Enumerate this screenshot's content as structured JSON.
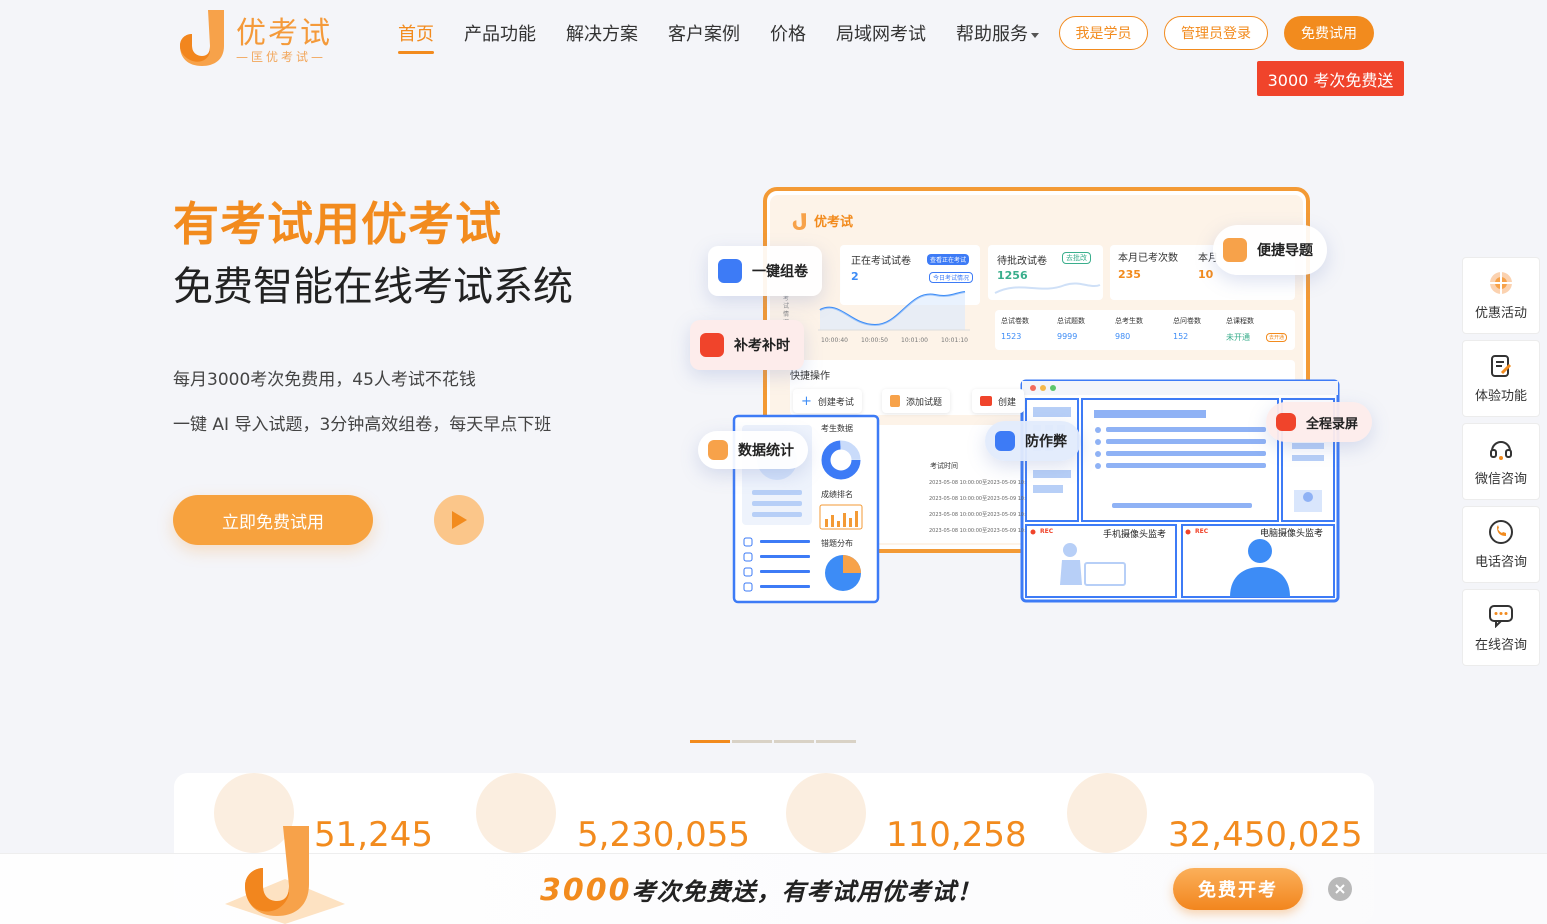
{
  "header": {
    "logo": {
      "title": "优考试",
      "subtitle": "—匡优考试—"
    },
    "nav": [
      {
        "label": "首页",
        "active": true
      },
      {
        "label": "产品功能"
      },
      {
        "label": "解决方案"
      },
      {
        "label": "客户案例"
      },
      {
        "label": "价格"
      },
      {
        "label": "局域网考试"
      },
      {
        "label": "帮助服务"
      }
    ],
    "student_btn": "我是学员",
    "admin_btn": "管理员登录",
    "trial_btn": "免费试用",
    "promo_tag": "3000 考次免费送"
  },
  "hero": {
    "title": "有考试用优考试",
    "subtitle": "免费智能在线考试系统",
    "line1": "每月3000考次免费用，45人考试不花钱",
    "line2": "一键 AI 导入试题，3分钟高效组卷，每天早点下班",
    "cta": "立即免费试用"
  },
  "illustration": {
    "app_name": "优考试",
    "chips": {
      "one_click": "一键组卷",
      "makeup": "补考补时",
      "data_stats": "数据统计",
      "anti_cheat": "防作弊",
      "quick_import": "便捷导题",
      "record": "全程录屏"
    },
    "cards": {
      "exams_in_progress": "正在考试试卷",
      "exams_in_progress_val": "2",
      "badge_view": "查看正在考试",
      "badge_today": "今日考试情况",
      "pending": "待批改试卷",
      "pending_val": "1256",
      "pending_badge": "去批改",
      "month_count": "本月已考次数",
      "month_count_val": "235",
      "month_extra": "本月",
      "month_extra_val": "10"
    },
    "chart_x": [
      "10:00:40",
      "10:00:50",
      "10:01:00",
      "10:01:10"
    ],
    "chart_ylabel": "考试情况",
    "totals": [
      {
        "label": "总试卷数",
        "value": "1523"
      },
      {
        "label": "总试题数",
        "value": "9999"
      },
      {
        "label": "总考生数",
        "value": "980"
      },
      {
        "label": "总问卷数",
        "value": "152"
      },
      {
        "label": "总课程数",
        "value": "未开通"
      }
    ],
    "totals_badge": "去开通",
    "quick_ops": "快捷操作",
    "ops": [
      "创建考试",
      "添加试题",
      "创建"
    ],
    "left_panel": {
      "candidates": "考生数据",
      "ranking": "成绩排名",
      "errors": "错题分布"
    },
    "exam_time": "考试时间",
    "exam_rows": [
      "2023-05-08 10:00:00至2023-05-09 10:",
      "2023-05-08 10:00:00至2023-05-09 10:",
      "2023-05-08 10:00:00至2023-05-09 10:",
      "2023-05-08 10:00:00至2023-05-09 10:"
    ],
    "monitor": {
      "rec": "REC",
      "phone": "手机摄像头监考",
      "pc": "电脑摄像头监考"
    }
  },
  "stats": [
    {
      "value": "51,245"
    },
    {
      "value": "5,230,055"
    },
    {
      "value": "110,258"
    },
    {
      "value": "32,450,025"
    }
  ],
  "sidebar": [
    {
      "label": "优惠活动",
      "icon": "gift-icon"
    },
    {
      "label": "体验功能",
      "icon": "edit-icon"
    },
    {
      "label": "微信咨询",
      "icon": "headset-icon"
    },
    {
      "label": "电话咨询",
      "icon": "phone-icon"
    },
    {
      "label": "在线咨询",
      "icon": "chat-icon"
    }
  ],
  "banner": {
    "big": "3000",
    "text": "考次免费送，有考试用优考试！",
    "button": "免费开考"
  },
  "colors": {
    "brand": "#f28b1e",
    "blue": "#3d7bf6",
    "promo_red": "#f0442b"
  }
}
